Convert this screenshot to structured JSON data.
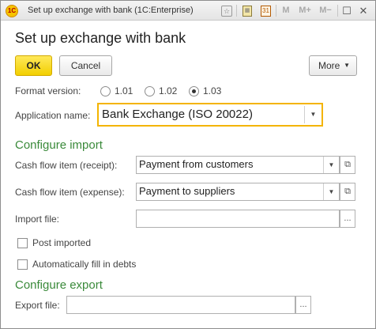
{
  "window": {
    "title": "Set up exchange with bank  (1C:Enterprise)",
    "app_logo_text": "1C"
  },
  "titlebar_tools": {
    "m_label": "M",
    "m_plus_label": "M+",
    "m_minus_label": "M−",
    "minimize": "—",
    "restore": "☐",
    "close": "✕"
  },
  "form": {
    "title": "Set up exchange with bank"
  },
  "toolbar": {
    "ok_label": "OK",
    "cancel_label": "Cancel",
    "more_label": "More"
  },
  "format_version": {
    "label": "Format version:",
    "options": [
      "1.01",
      "1.02",
      "1.03"
    ],
    "selected": "1.03"
  },
  "application": {
    "label": "Application name:",
    "value": "Bank Exchange (ISO 20022)"
  },
  "import_section": {
    "heading": "Configure import",
    "receipt_label": "Cash flow item (receipt):",
    "receipt_value": "Payment from customers",
    "expense_label": "Cash flow item (expense):",
    "expense_value": "Payment to suppliers",
    "import_file_label": "Import file:",
    "import_file_value": "",
    "browse_label": "...",
    "post_imported_label": "Post imported",
    "post_imported_checked": false,
    "autofill_label": "Automatically fill in debts",
    "autofill_checked": false
  },
  "export_section": {
    "heading": "Configure export",
    "export_file_label": "Export file:",
    "export_file_value": "",
    "browse_label": "..."
  },
  "colors": {
    "accent_yellow": "#f2cf00",
    "section_green": "#3a8a3a",
    "focus_border": "#f4b400"
  }
}
